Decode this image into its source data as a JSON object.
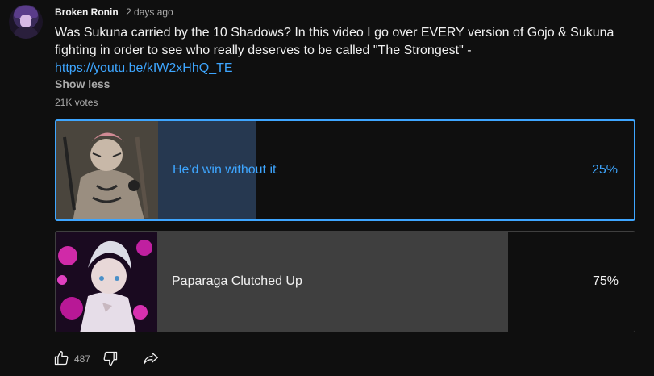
{
  "post": {
    "author": "Broken Ronin",
    "time": "2 days ago",
    "text": "Was Sukuna carried by the 10 Shadows? In this video I go over EVERY version of Gojo & Sukuna fighting in order to see who really deserves to be called \"The Strongest\" -",
    "link": "https://youtu.be/kIW2xHhQ_TE",
    "show_less": "Show less",
    "votes": "21K votes"
  },
  "poll": {
    "options": [
      {
        "label": "He'd win without it",
        "percent_text": "25%",
        "percent": 25,
        "selected": true
      },
      {
        "label": "Paparaga Clutched Up",
        "percent_text": "75%",
        "percent": 75,
        "selected": false
      }
    ]
  },
  "actions": {
    "like_count": "487",
    "icons": [
      "thumbs-up-icon",
      "thumbs-down-icon",
      "share-icon"
    ]
  },
  "colors": {
    "background": "#0f0f0f",
    "accent": "#3ea6ff",
    "selected_fill": "#263850",
    "unselected_fill": "#3f3f3f"
  }
}
